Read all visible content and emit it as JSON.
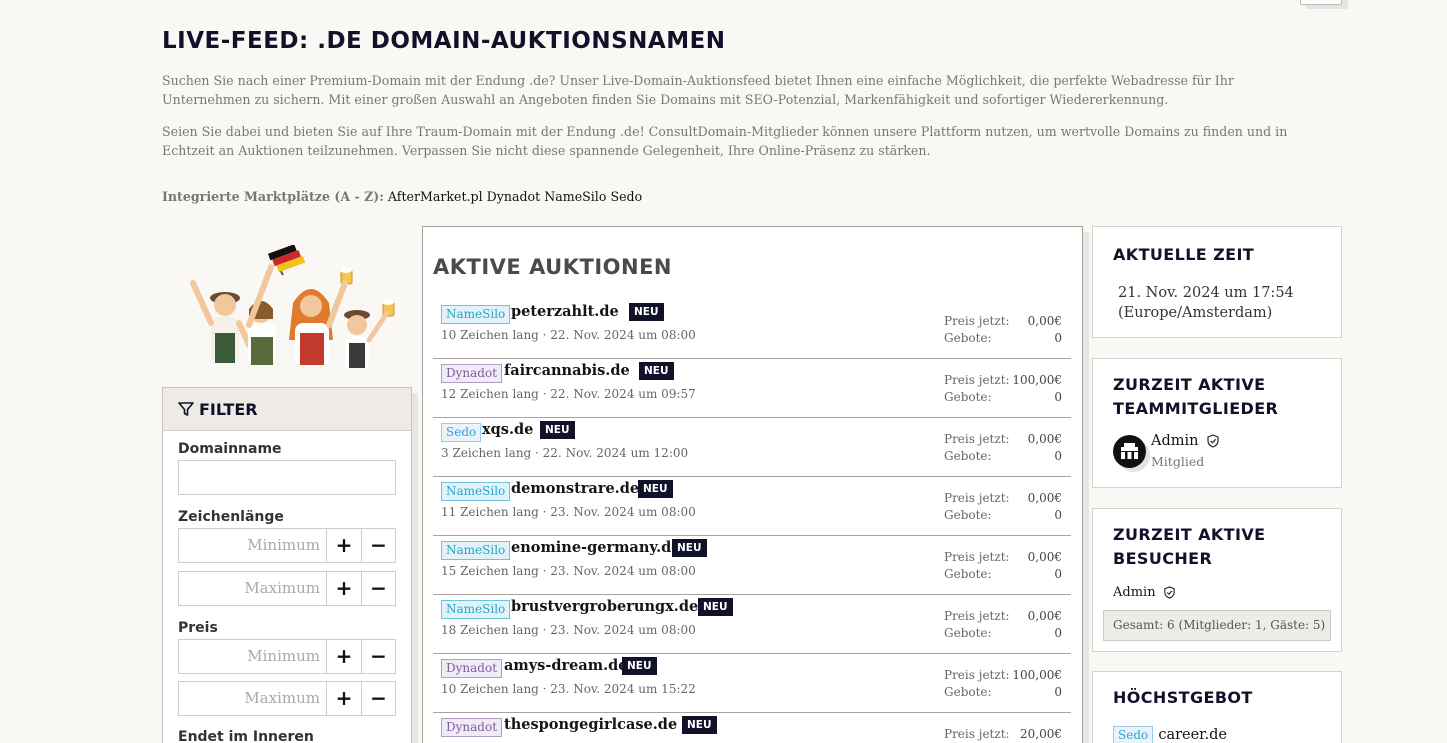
{
  "page": {
    "title": "Live-Feed: .de Domain-Auktionsnamen",
    "intro_1": "Suchen Sie nach einer Premium-Domain mit der Endung .de? Unser Live-Domain-Auktionsfeed bietet Ihnen eine einfache Möglichkeit, die perfekte Webadresse für Ihr Unternehmen zu sichern. Mit einer großen Auswahl an Angeboten finden Sie Domains mit SEO-Potenzial, Markenfähigkeit und sofortiger Wiedererkennung.",
    "intro_2": "Seien Sie dabei und bieten Sie auf Ihre Traum-Domain mit der Endung .de! ConsultDomain-Mitglieder können unsere Plattform nutzen, um wertvolle Domains zu finden und in Echtzeit an Auktionen teilzunehmen. Verpassen Sie nicht diese spannende Gelegenheit, Ihre Online-Präsenz zu stärken.",
    "markets_label": "Integrierte Marktplätze (A - Z):",
    "markets": [
      "AfterMarket.pl",
      "Dynadot",
      "NameSilo",
      "Sedo"
    ]
  },
  "filter": {
    "title": "Filter",
    "domainname_label": "Domainname",
    "zeichenlaenge_label": "Zeichenlänge",
    "preis_label": "Preis",
    "endet_label": "Endet im Inneren",
    "min_placeholder": "Minimum",
    "max_placeholder": "Maximum",
    "plus": "+",
    "minus": "−"
  },
  "auctions": {
    "title": "Aktive Auktionen",
    "price_label": "Preis jetzt:",
    "bids_label": "Gebote:",
    "new_badge": "NEU",
    "items": [
      {
        "market": "NameSilo",
        "domain": "peterzahlt.de",
        "meta": "10 Zeichen lang · 22. Nov. 2024 um 08:00",
        "price": "0,00€",
        "bids": "0"
      },
      {
        "market": "Dynadot",
        "domain": "faircannabis.de",
        "meta": "12 Zeichen lang · 22. Nov. 2024 um 09:57",
        "price": "100,00€",
        "bids": "0"
      },
      {
        "market": "Sedo",
        "domain": "xqs.de",
        "meta": "3 Zeichen lang · 22. Nov. 2024 um 12:00",
        "price": "0,00€",
        "bids": "0"
      },
      {
        "market": "NameSilo",
        "domain": "demonstrare.de",
        "meta": "11 Zeichen lang · 23. Nov. 2024 um 08:00",
        "price": "0,00€",
        "bids": "0"
      },
      {
        "market": "NameSilo",
        "domain": "enomine-germany.de",
        "meta": "15 Zeichen lang · 23. Nov. 2024 um 08:00",
        "price": "0,00€",
        "bids": "0"
      },
      {
        "market": "NameSilo",
        "domain": "brustvergroberungx.de",
        "meta": "18 Zeichen lang · 23. Nov. 2024 um 08:00",
        "price": "0,00€",
        "bids": "0"
      },
      {
        "market": "Dynadot",
        "domain": "amys-dream.de",
        "meta": "10 Zeichen lang · 23. Nov. 2024 um 15:22",
        "price": "100,00€",
        "bids": "0"
      },
      {
        "market": "Dynadot",
        "domain": "thespongegirlcase.de",
        "meta": "",
        "price": "20,00€",
        "bids": ""
      }
    ]
  },
  "time_card": {
    "title": "Aktuelle Zeit",
    "value_line1": "21. Nov. 2024 um 17:54",
    "value_line2": "(Europe/Amsterdam)"
  },
  "team_card": {
    "title_line1": "Zurzeit aktive",
    "title_line2": "Teammitglieder",
    "member_name": "Admin",
    "member_role": "Mitglied"
  },
  "visitors_card": {
    "title_line1": "Zurzeit aktive",
    "title_line2": "Besucher",
    "visitor_name": "Admin",
    "totals": "Gesamt: 6 (Mitglieder: 1, Gäste: 5)"
  },
  "highbid_card": {
    "title": "Höchstgebot",
    "market": "Sedo",
    "domain": "career.de"
  }
}
